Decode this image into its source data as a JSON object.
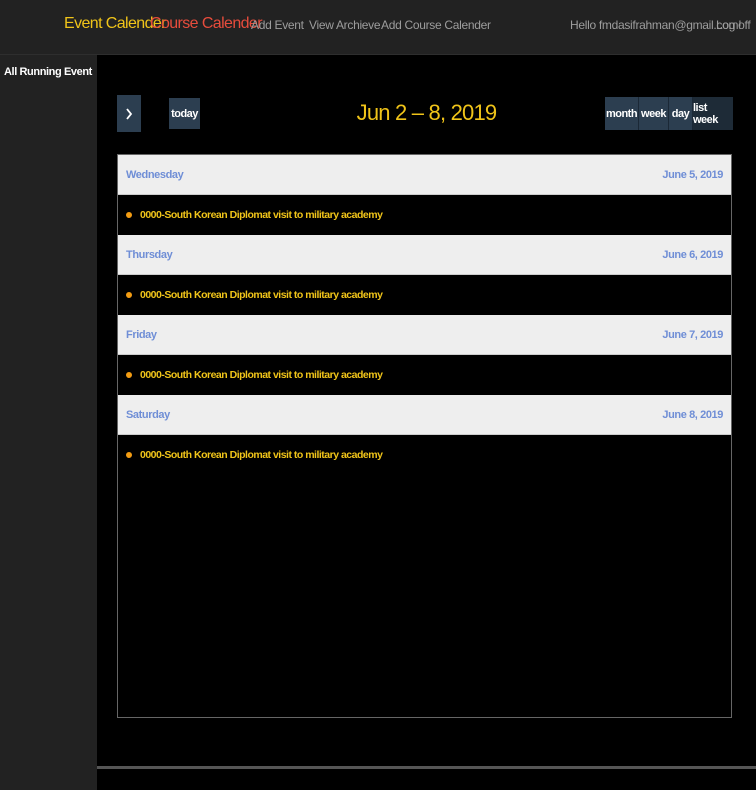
{
  "navbar": {
    "brand_event": "Event Calender",
    "brand_course": "Course Calender",
    "links": [
      "Add Event",
      "View Archieve",
      "Add Course Calender"
    ],
    "user_greeting": "Hello fmdasifrahman@gmail.com!",
    "logoff": "Log off"
  },
  "sidebar": {
    "items": [
      {
        "label": "All Running Event"
      }
    ]
  },
  "calendar": {
    "title": "Jun 2 – 8, 2019",
    "prev_icon": "chevron-left",
    "next_icon": "chevron-right",
    "today_label": "today",
    "views": [
      "month",
      "week",
      "day",
      "list week"
    ],
    "days": [
      {
        "day": "Wednesday",
        "date": "June 5, 2019",
        "events": [
          {
            "title": "0000-South Korean Diplomat visit to military academy",
            "color": "#f39c12"
          }
        ]
      },
      {
        "day": "Thursday",
        "date": "June 6, 2019",
        "events": [
          {
            "title": "0000-South Korean Diplomat visit to military academy",
            "color": "#f39c12"
          }
        ]
      },
      {
        "day": "Friday",
        "date": "June 7, 2019",
        "events": [
          {
            "title": "0000-South Korean Diplomat visit to military academy",
            "color": "#f39c12"
          }
        ]
      },
      {
        "day": "Saturday",
        "date": "June 8, 2019",
        "events": [
          {
            "title": "0000-South Korean Diplomat visit to military academy",
            "color": "#f39c12"
          }
        ]
      }
    ]
  },
  "colors": {
    "brand_event": "#f0c419",
    "brand_course": "#e74c3c",
    "day_header_text": "#6f8ed6",
    "event_text": "#f0c419"
  }
}
